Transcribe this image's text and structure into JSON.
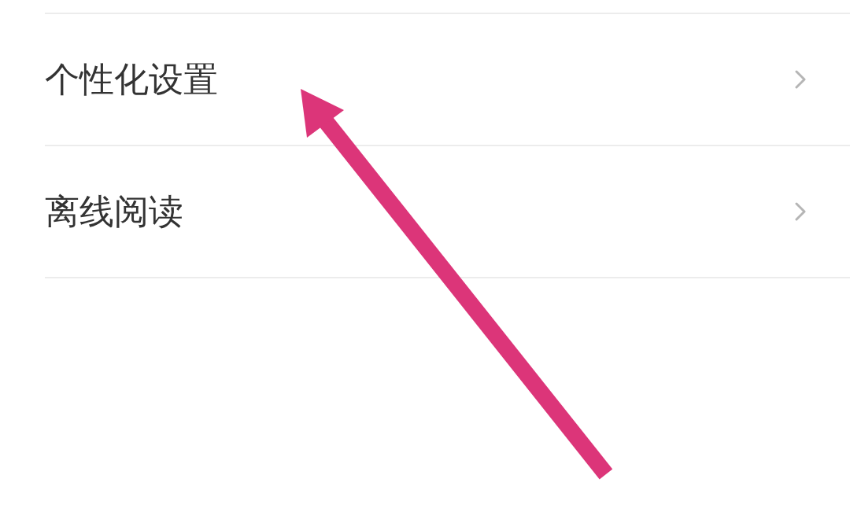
{
  "settings_list": {
    "items": [
      {
        "label": "个性化设置"
      },
      {
        "label": "离线阅读"
      }
    ]
  }
}
